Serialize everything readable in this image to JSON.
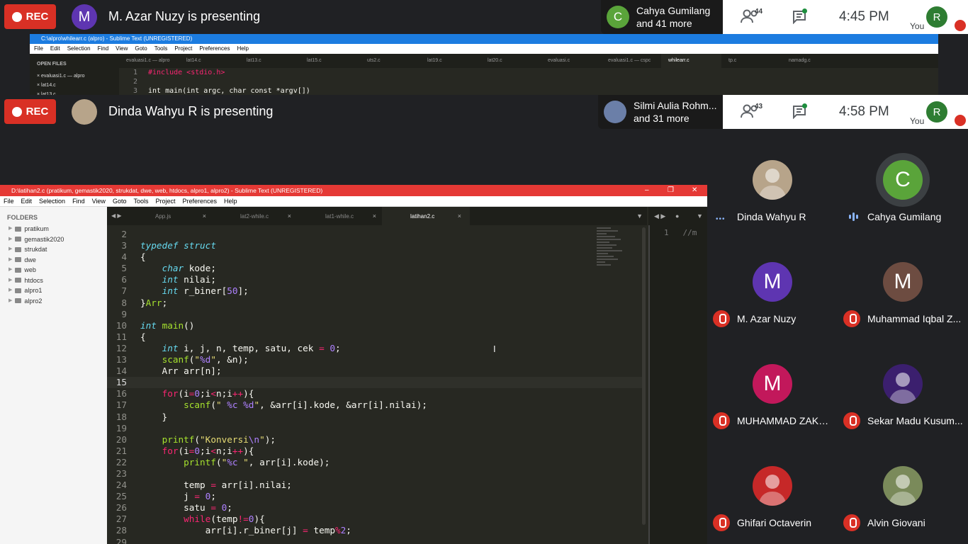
{
  "meet_top": {
    "rec_label": "REC",
    "presenter_initial": "M",
    "presenting_text": "M. Azar Nuzy is presenting",
    "join_initial": "C",
    "join_line1": "Cahya Gumilang",
    "join_line2": "and 41 more",
    "people_count": "44",
    "time": "4:45 PM",
    "you_initial": "R",
    "you_label": "You"
  },
  "meet_second": {
    "rec_label": "REC",
    "presenting_text": "Dinda Wahyu R is presenting",
    "join_line1": "Silmi Aulia Rohm...",
    "join_line2": "and 31 more",
    "people_count": "43",
    "time": "4:58 PM",
    "you_initial": "R",
    "you_label": "You"
  },
  "sublime_top": {
    "title": "C:\\alpro\\whilearr.c (alpro) - Sublime Text (UNREGISTERED)",
    "menu": [
      "File",
      "Edit",
      "Selection",
      "Find",
      "View",
      "Goto",
      "Tools",
      "Project",
      "Preferences",
      "Help"
    ],
    "open_files_header": "OPEN FILES",
    "open_files": [
      "evaluasi1.c — alpro",
      "lat14.c",
      "lat13.c"
    ],
    "tabs": [
      "evaluasi1.c — alpro",
      "lat14.c",
      "lat13.c",
      "lat15.c",
      "uts2.c",
      "lat19.c",
      "lat20.c",
      "evaluasi.c",
      "evaluasi1.c — cspc",
      "whilearr.c",
      "tp.c",
      "namadg.c"
    ],
    "active_tab": 9,
    "lines": [
      {
        "n": "1",
        "code": "#include <stdio.h>"
      },
      {
        "n": "2",
        "code": ""
      },
      {
        "n": "3",
        "code": "int main(int argc, char const *argv[])"
      }
    ]
  },
  "sublime": {
    "title": "D:\\latihan2.c (pratikum, gemastik2020, strukdat, dwe, web, htdocs, alpro1, alpro2) - Sublime Text (UNREGISTERED)",
    "menu": [
      "File",
      "Edit",
      "Selection",
      "Find",
      "View",
      "Goto",
      "Tools",
      "Project",
      "Preferences",
      "Help"
    ],
    "folders_header": "FOLDERS",
    "folders": [
      "pratikum",
      "gemastik2020",
      "strukdat",
      "dwe",
      "web",
      "htdocs",
      "alpro1",
      "alpro2"
    ],
    "tabs": [
      "App.js",
      "lat2-while.c",
      "lat1-while.c",
      "latihan2.c"
    ],
    "active_tab": 3,
    "right_pane_line": "1",
    "right_pane_text": "//m",
    "current_line": "15",
    "lines": [
      {
        "n": "2",
        "html": ""
      },
      {
        "n": "3",
        "html": "<span class='ty'>typedef</span> <span class='ty'>struct</span>"
      },
      {
        "n": "4",
        "html": "{"
      },
      {
        "n": "5",
        "html": "    <span class='ty'>char</span> kode;"
      },
      {
        "n": "6",
        "html": "    <span class='ty'>int</span> nilai;"
      },
      {
        "n": "7",
        "html": "    <span class='ty'>int</span> r_biner[<span class='nm'>50</span>];"
      },
      {
        "n": "8",
        "html": "}<span class='fn'>Arr</span>;"
      },
      {
        "n": "9",
        "html": ""
      },
      {
        "n": "10",
        "html": "<span class='ty'>int</span> <span class='fn'>main</span>()"
      },
      {
        "n": "11",
        "html": "{"
      },
      {
        "n": "12",
        "html": "    <span class='ty'>int</span> i, j, n, temp, satu, cek <span class='kw'>=</span> <span class='nm'>0</span>;"
      },
      {
        "n": "13",
        "html": "    <span class='fn'>scanf</span>(<span class='st'>\"<span class='nm'>%d</span>\"</span>, &amp;n);"
      },
      {
        "n": "14",
        "html": "    Arr arr[n];"
      },
      {
        "n": "15",
        "html": ""
      },
      {
        "n": "16",
        "html": "    <span class='kw'>for</span>(i<span class='kw'>=</span><span class='nm'>0</span>;i<span class='kw'>&lt;</span>n;i<span class='kw'>++</span>){"
      },
      {
        "n": "17",
        "html": "        <span class='fn'>scanf</span>(<span class='st'>\" <span class='nm'>%c</span> <span class='nm'>%d</span>\"</span>, &amp;arr[i].kode, &amp;arr[i].nilai);"
      },
      {
        "n": "18",
        "html": "    }"
      },
      {
        "n": "19",
        "html": ""
      },
      {
        "n": "20",
        "html": "    <span class='fn'>printf</span>(<span class='st'>\"Konversi<span class='nm'>\\n</span>\"</span>);"
      },
      {
        "n": "21",
        "html": "    <span class='kw'>for</span>(i<span class='kw'>=</span><span class='nm'>0</span>;i<span class='kw'>&lt;</span>n;i<span class='kw'>++</span>){"
      },
      {
        "n": "22",
        "html": "        <span class='fn'>printf</span>(<span class='st'>\"<span class='nm'>%c</span> \"</span>, arr[i].kode);"
      },
      {
        "n": "23",
        "html": ""
      },
      {
        "n": "24",
        "html": "        temp <span class='kw'>=</span> arr[i].nilai;"
      },
      {
        "n": "25",
        "html": "        j <span class='kw'>=</span> <span class='nm'>0</span>;"
      },
      {
        "n": "26",
        "html": "        satu <span class='kw'>=</span> <span class='nm'>0</span>;"
      },
      {
        "n": "27",
        "html": "        <span class='kw'>while</span>(temp<span class='kw'>!=</span><span class='nm'>0</span>){"
      },
      {
        "n": "28",
        "html": "            arr[i].r_biner[j] <span class='kw'>=</span> temp<span class='kw'>%</span><span class='nm'>2</span>;"
      },
      {
        "n": "29",
        "html": ""
      }
    ]
  },
  "participants": [
    {
      "name": "Dinda Wahyu R",
      "initial": "",
      "color": "#b7a48a",
      "status": "dots",
      "photo": "avatar-photo-dinda"
    },
    {
      "name": "Cahya Gumilang",
      "initial": "C",
      "color": "#5aa43a",
      "status": "speaking",
      "halo": true
    },
    {
      "name": "M. Azar Nuzy",
      "initial": "M",
      "color": "#5e35b1",
      "status": "muted"
    },
    {
      "name": "Muhammad Iqbal Z...",
      "initial": "M",
      "color": "#6d4c41",
      "status": "muted"
    },
    {
      "name": "MUHAMMAD ZAKA...",
      "initial": "M",
      "color": "#c2185b",
      "status": "muted"
    },
    {
      "name": "Sekar Madu Kusum...",
      "initial": "",
      "color": "#3b1f6e",
      "status": "muted",
      "photo": "avatar-photo-nebula"
    },
    {
      "name": "Ghifari Octaverin",
      "initial": "",
      "color": "#c62828",
      "status": "muted",
      "photo": "avatar-photo-ghifari"
    },
    {
      "name": "Alvin Giovani",
      "initial": "",
      "color": "#7a8a5a",
      "status": "muted",
      "photo": "avatar-photo-alvin"
    }
  ]
}
